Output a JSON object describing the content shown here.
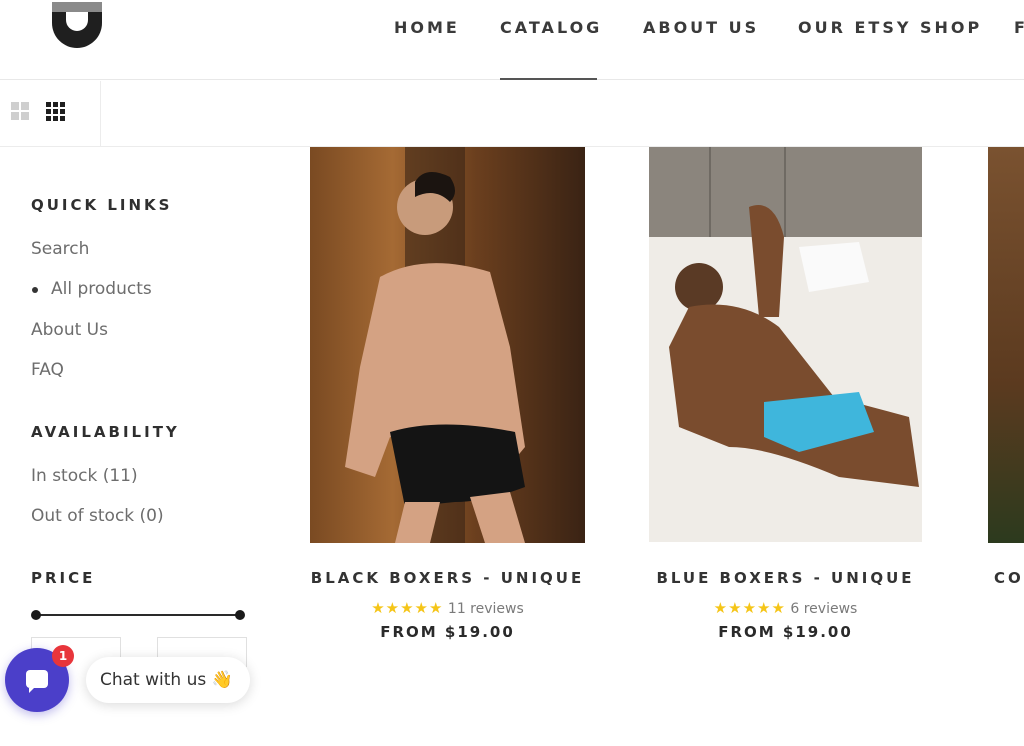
{
  "header": {
    "nav": [
      {
        "label": "HOME"
      },
      {
        "label": "CATALOG"
      },
      {
        "label": "ABOUT US"
      },
      {
        "label": "OUR ETSY SHOP"
      },
      {
        "label": "F"
      }
    ],
    "active_nav": "CATALOG"
  },
  "toolbar": {
    "view_icons": [
      "grid-2-icon",
      "grid-3-icon"
    ]
  },
  "sidebar": {
    "quick_links": {
      "title": "QUICK LINKS",
      "items": [
        {
          "label": "Search"
        },
        {
          "label": "All products"
        },
        {
          "label": "About Us"
        },
        {
          "label": "FAQ"
        }
      ]
    },
    "availability": {
      "title": "AVAILABILITY",
      "items": [
        {
          "label": "In stock (11)"
        },
        {
          "label": "Out of stock (0)"
        }
      ]
    },
    "price": {
      "title": "PRICE"
    }
  },
  "products": [
    {
      "title": "BLACK BOXERS - UNIQUE",
      "stars": "★★★★★",
      "reviews": "11 reviews",
      "price": "FROM $19.00"
    },
    {
      "title": "BLUE BOXERS - UNIQUE",
      "stars": "★★★★★",
      "reviews": "6 reviews",
      "price": "FROM $19.00"
    },
    {
      "title": "CO",
      "stars": "",
      "reviews": "",
      "price": ""
    }
  ],
  "chat": {
    "badge": "1",
    "label": "Chat with us",
    "emoji": "👋"
  },
  "colors": {
    "accent": "#4b3fc9",
    "badge": "#e8353b",
    "star": "#f5c518"
  }
}
